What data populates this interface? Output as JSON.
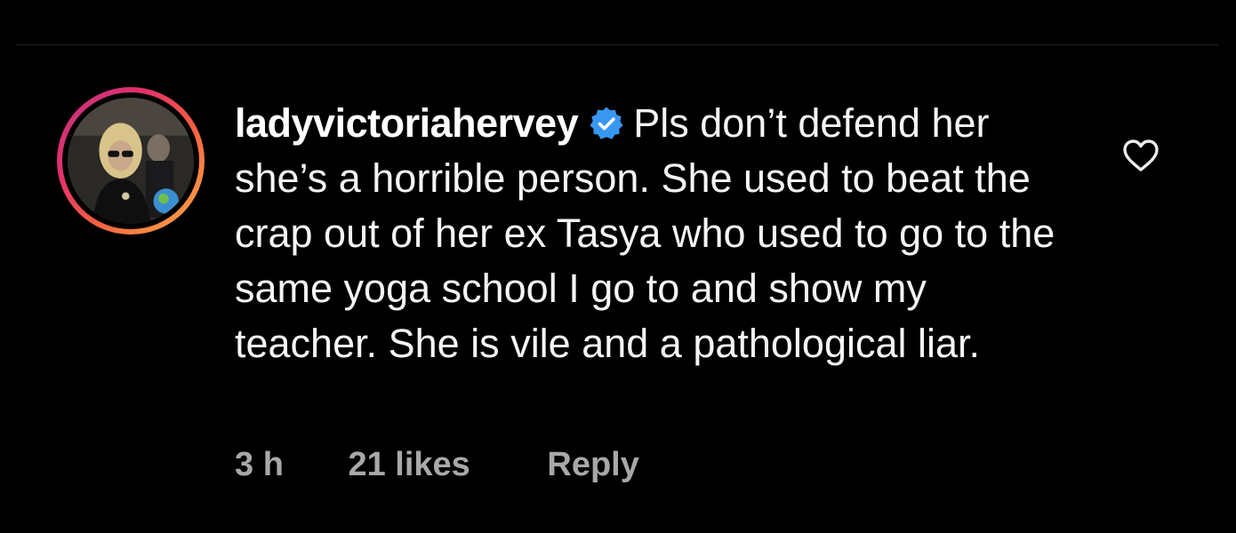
{
  "comment": {
    "username": "ladyvictoriahervey",
    "verified_icon": "verified-badge-icon",
    "text": "Pls don’t defend her she’s a horrible person. She used to beat the crap out of her ex Tasya who used to go  to the same yoga school I go to and show my teacher. She is vile and a pathological liar.",
    "time": "3 h",
    "likes": "21 likes",
    "reply_label": "Reply",
    "like_icon": "heart-icon"
  },
  "colors": {
    "background": "#000000",
    "text": "#f5f5f5",
    "meta": "#a8a8a8",
    "verified_badge": "#3897f0",
    "story_ring": [
      "#c13584",
      "#e1306c",
      "#f56040",
      "#fcaf45"
    ]
  }
}
